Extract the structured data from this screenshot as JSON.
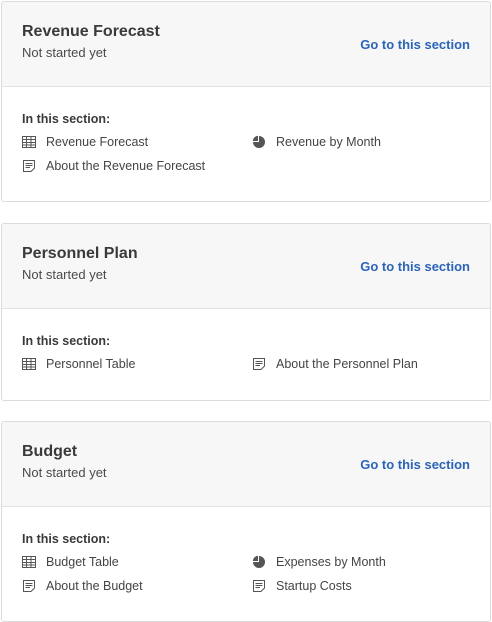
{
  "sections": [
    {
      "title": "Revenue Forecast",
      "status": "Not started yet",
      "link_label": "Go to this section",
      "in_section_label": "In this section:",
      "items": [
        {
          "label": "Revenue Forecast",
          "icon": "table-icon"
        },
        {
          "label": "Revenue by Month",
          "icon": "pie-chart-icon"
        },
        {
          "label": "About the Revenue Forecast",
          "icon": "document-icon"
        }
      ]
    },
    {
      "title": "Personnel Plan",
      "status": "Not started yet",
      "link_label": "Go to this section",
      "in_section_label": "In this section:",
      "items": [
        {
          "label": "Personnel Table",
          "icon": "table-icon"
        },
        {
          "label": "About the Personnel Plan",
          "icon": "document-icon"
        }
      ]
    },
    {
      "title": "Budget",
      "status": "Not started yet",
      "link_label": "Go to this section",
      "in_section_label": "In this section:",
      "items": [
        {
          "label": "Budget Table",
          "icon": "table-icon"
        },
        {
          "label": "Expenses by Month",
          "icon": "pie-chart-icon"
        },
        {
          "label": "About the Budget",
          "icon": "document-icon"
        },
        {
          "label": "Startup Costs",
          "icon": "document-icon"
        }
      ]
    }
  ],
  "colors": {
    "link": "#2b64b8",
    "header_bg": "#f7f7f7",
    "border": "#dcdcdc",
    "icon": "#555555"
  }
}
